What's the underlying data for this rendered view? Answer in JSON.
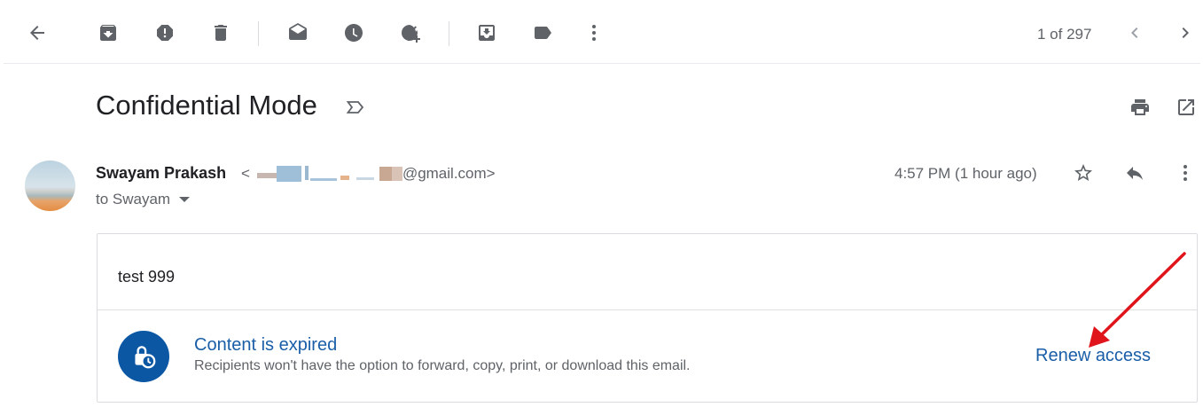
{
  "toolbar": {
    "icons": [
      "back-icon",
      "archive-icon",
      "report-spam-icon",
      "delete-icon",
      "mark-unread-icon",
      "snooze-icon",
      "add-to-tasks-icon",
      "move-to-icon",
      "labels-icon",
      "more-vert-icon"
    ],
    "pager_text": "1 of 297"
  },
  "message": {
    "subject": "Confidential Mode",
    "sender_name": "Swayam Prakash",
    "sender_email_prefix": "<",
    "sender_email_suffix": "@gmail.com>",
    "to_line": "to Swayam",
    "timestamp": "4:57 PM (1 hour ago)",
    "body": "test 999"
  },
  "notice": {
    "title": "Content is expired",
    "description": "Recipients won't have the option to forward, copy, print, or download this email.",
    "renew_label": "Renew access"
  },
  "colors": {
    "accent": "#1a5ea8",
    "lock_badge": "#0b57a4",
    "annotation_arrow": "#e0141b",
    "icon_gray": "#5f6368"
  }
}
